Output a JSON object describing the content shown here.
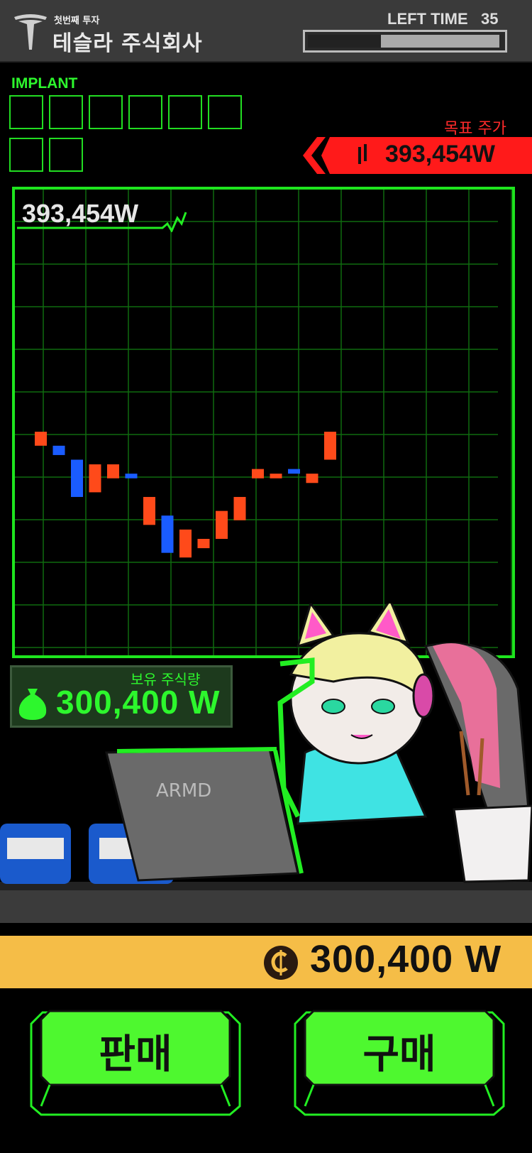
{
  "header": {
    "company_sub": "첫번째 투자",
    "company_name": "테슬라 주식회사",
    "left_time_label": "LEFT TIME",
    "left_time_value": "35",
    "time_remaining_fraction": 0.62
  },
  "implant": {
    "label": "IMPLANT",
    "slots": 8
  },
  "target": {
    "label": "목표 주가",
    "value": "393,454W"
  },
  "chart": {
    "current_price": "393,454W"
  },
  "chart_data": {
    "type": "candlestick",
    "title": "",
    "up_color": "#ff4a1a",
    "down_color": "#1a5cff",
    "grid": true,
    "candles": [
      {
        "dir": "up",
        "open": 0.52,
        "close": 0.55
      },
      {
        "dir": "down",
        "open": 0.55,
        "close": 0.57
      },
      {
        "dir": "down",
        "open": 0.58,
        "close": 0.66
      },
      {
        "dir": "up",
        "open": 0.65,
        "close": 0.59
      },
      {
        "dir": "up",
        "open": 0.62,
        "close": 0.59
      },
      {
        "dir": "down",
        "open": 0.61,
        "close": 0.62
      },
      {
        "dir": "up",
        "open": 0.72,
        "close": 0.66
      },
      {
        "dir": "down",
        "open": 0.7,
        "close": 0.78
      },
      {
        "dir": "up",
        "open": 0.79,
        "close": 0.73
      },
      {
        "dir": "up",
        "open": 0.77,
        "close": 0.75
      },
      {
        "dir": "up",
        "open": 0.75,
        "close": 0.69
      },
      {
        "dir": "up",
        "open": 0.71,
        "close": 0.66
      },
      {
        "dir": "up",
        "open": 0.62,
        "close": 0.6
      },
      {
        "dir": "up",
        "open": 0.62,
        "close": 0.61
      },
      {
        "dir": "down",
        "open": 0.6,
        "close": 0.61
      },
      {
        "dir": "up",
        "open": 0.63,
        "close": 0.61
      },
      {
        "dir": "up",
        "open": 0.58,
        "close": 0.52
      }
    ]
  },
  "holdings": {
    "label": "보유 주식량",
    "value": "300,400 W"
  },
  "cash": {
    "value": "300,400 W"
  },
  "laptop_brand": "ARMD",
  "buttons": {
    "sell": "판매",
    "buy": "구매"
  },
  "colors": {
    "accent_green": "#22ee22",
    "target_red": "#ff1a1a",
    "cash_yellow": "#f5bd47"
  }
}
